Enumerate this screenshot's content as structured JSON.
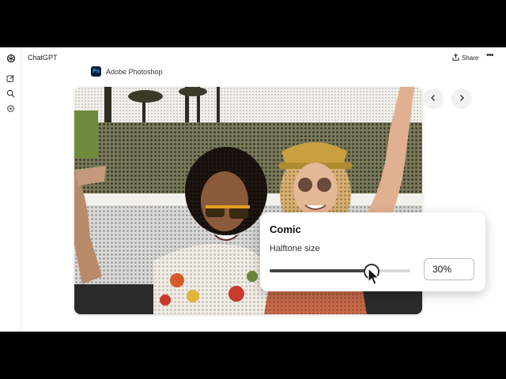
{
  "app": {
    "title": "ChatGPT"
  },
  "header": {
    "share_label": "Share",
    "more_label": "•••"
  },
  "integration": {
    "name": "Adobe Photoshop",
    "logo_text": "Ps"
  },
  "rail": {
    "icons": [
      "openai-logo-icon",
      "new-chat-icon",
      "search-icon",
      "library-icon"
    ]
  },
  "carousel": {
    "prev_icon": "chevron-left-icon",
    "next_icon": "chevron-right-icon"
  },
  "effect_panel": {
    "title": "Comic",
    "control_label": "Halftone size",
    "slider_fraction": 0.72,
    "value": "30%"
  },
  "colors": {
    "ps_bg": "#001e36",
    "ps_accent": "#31a8ff",
    "slider": "#444444"
  }
}
